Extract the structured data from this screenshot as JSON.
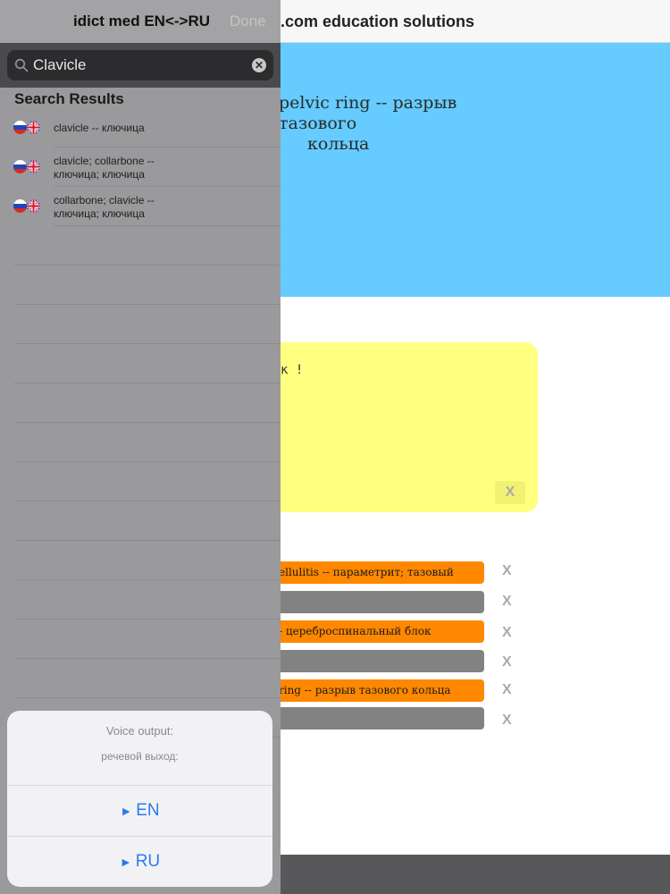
{
  "background_page": {
    "title": ".com education solutions",
    "hero_line1": "pelvic ring -- разрыв тазового",
    "hero_line2": "кольца",
    "card_text": "к !",
    "card_close": "X",
    "rows": [
      {
        "color": "orange",
        "text": "ellulitis -- параметрит; тазовый",
        "close": "X"
      },
      {
        "color": "gray",
        "text": "",
        "close": "X"
      },
      {
        "color": "orange",
        "text": "- цереброспинальный блок",
        "close": "X"
      },
      {
        "color": "gray",
        "text": "",
        "close": "X"
      },
      {
        "color": "orange",
        "text": "ring -- разрыв тазового кольца",
        "close": "X"
      },
      {
        "color": "gray",
        "text": "",
        "close": "X"
      }
    ]
  },
  "panel": {
    "title": "idict med EN<->RU",
    "done_label": "Done",
    "search": {
      "value": "Clavicle",
      "clear_glyph": "✕"
    },
    "section_title": "Search Results",
    "results": [
      {
        "line1": "clavicle -- ключица",
        "line2": ""
      },
      {
        "line1": "clavicle; collarbone --",
        "line2": "ключица; ключица"
      },
      {
        "line1": "collarbone; clavicle --",
        "line2": "ключица; ключица"
      }
    ]
  },
  "voice_sheet": {
    "title": "Voice output:",
    "subtitle": "речевой выход:",
    "buttons": [
      {
        "arrow": "►",
        "label": "EN"
      },
      {
        "arrow": "►",
        "label": "RU"
      }
    ]
  },
  "colors": {
    "hero": "#66ccff",
    "card": "#ffff80",
    "row_orange": "#ff8800",
    "row_gray": "#828282",
    "accent_blue": "#2a7bf0"
  }
}
